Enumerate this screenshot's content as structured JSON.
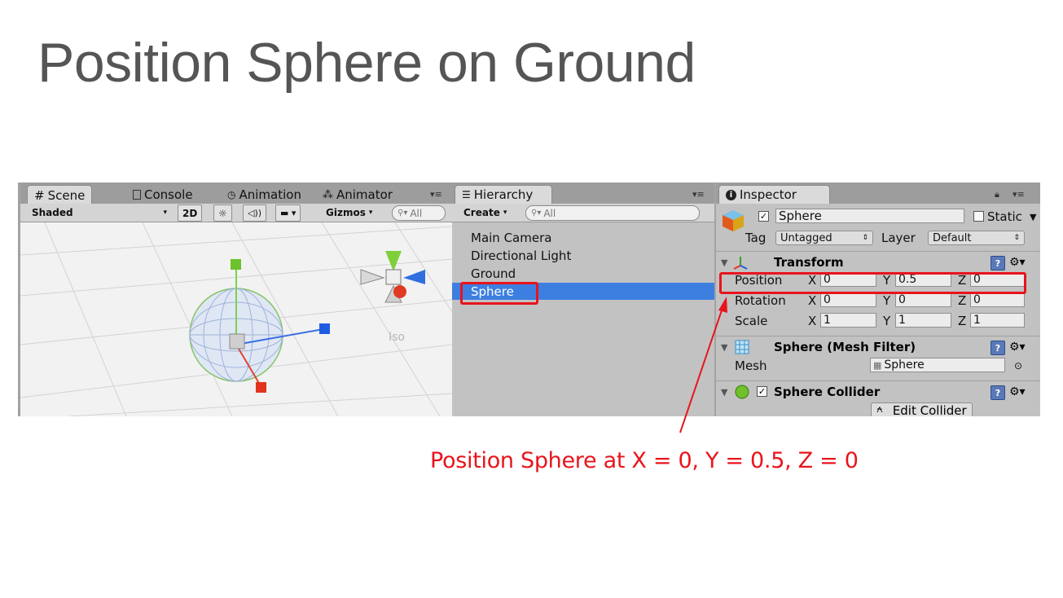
{
  "slide": {
    "title": "Position Sphere on Ground",
    "note": "Position Sphere at X = 0, Y = 0.5, Z = 0"
  },
  "scene": {
    "tabs": [
      {
        "icon": "grid-icon",
        "label": "Scene"
      },
      {
        "icon": "console-icon",
        "label": "Console"
      },
      {
        "icon": "clock-icon",
        "label": "Animation"
      },
      {
        "icon": "animator-icon",
        "label": "Animator"
      }
    ],
    "toolbar": {
      "draw_mode": "Shaded",
      "mode_2d": "2D",
      "gizmos": "Gizmos",
      "search_placeholder": "All"
    },
    "iso_label": "Iso"
  },
  "hierarchy": {
    "tab_label": "Hierarchy",
    "create_label": "Create",
    "search_placeholder": "All",
    "items": [
      "Main Camera",
      "Directional Light",
      "Ground",
      "Sphere"
    ],
    "selected": "Sphere"
  },
  "inspector": {
    "tab_label": "Inspector",
    "object_name": "Sphere",
    "static_label": "Static",
    "tag_label": "Tag",
    "tag_value": "Untagged",
    "layer_label": "Layer",
    "layer_value": "Default",
    "transform": {
      "title": "Transform",
      "rows": [
        {
          "label": "Position",
          "x": "0",
          "y": "0.5",
          "z": "0"
        },
        {
          "label": "Rotation",
          "x": "0",
          "y": "0",
          "z": "0"
        },
        {
          "label": "Scale",
          "x": "1",
          "y": "1",
          "z": "1"
        }
      ]
    },
    "mesh_filter": {
      "title": "Sphere (Mesh Filter)",
      "mesh_label": "Mesh",
      "mesh_value": "Sphere"
    },
    "sphere_collider": {
      "title": "Sphere Collider",
      "edit_button": "Edit Collider"
    }
  },
  "colors": {
    "accent_red": "#e8141c",
    "selection_blue": "#3d7fe0"
  }
}
